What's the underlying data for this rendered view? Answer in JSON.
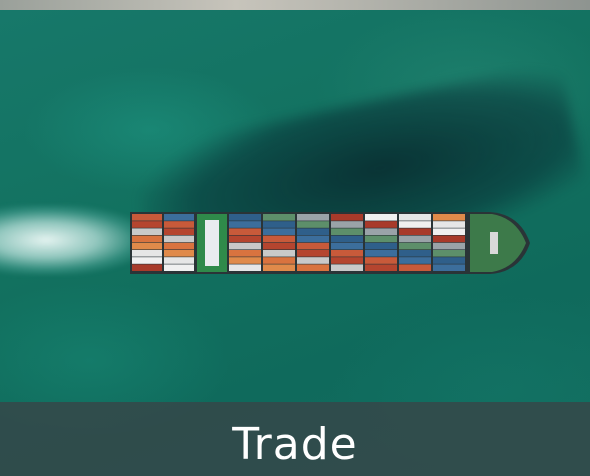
{
  "card": {
    "caption": "Trade",
    "image_subject": "container-ship-aerial-view"
  },
  "colors": {
    "sea": "#12715f",
    "caption_bar": "#374648",
    "caption_text": "#ffffff"
  }
}
